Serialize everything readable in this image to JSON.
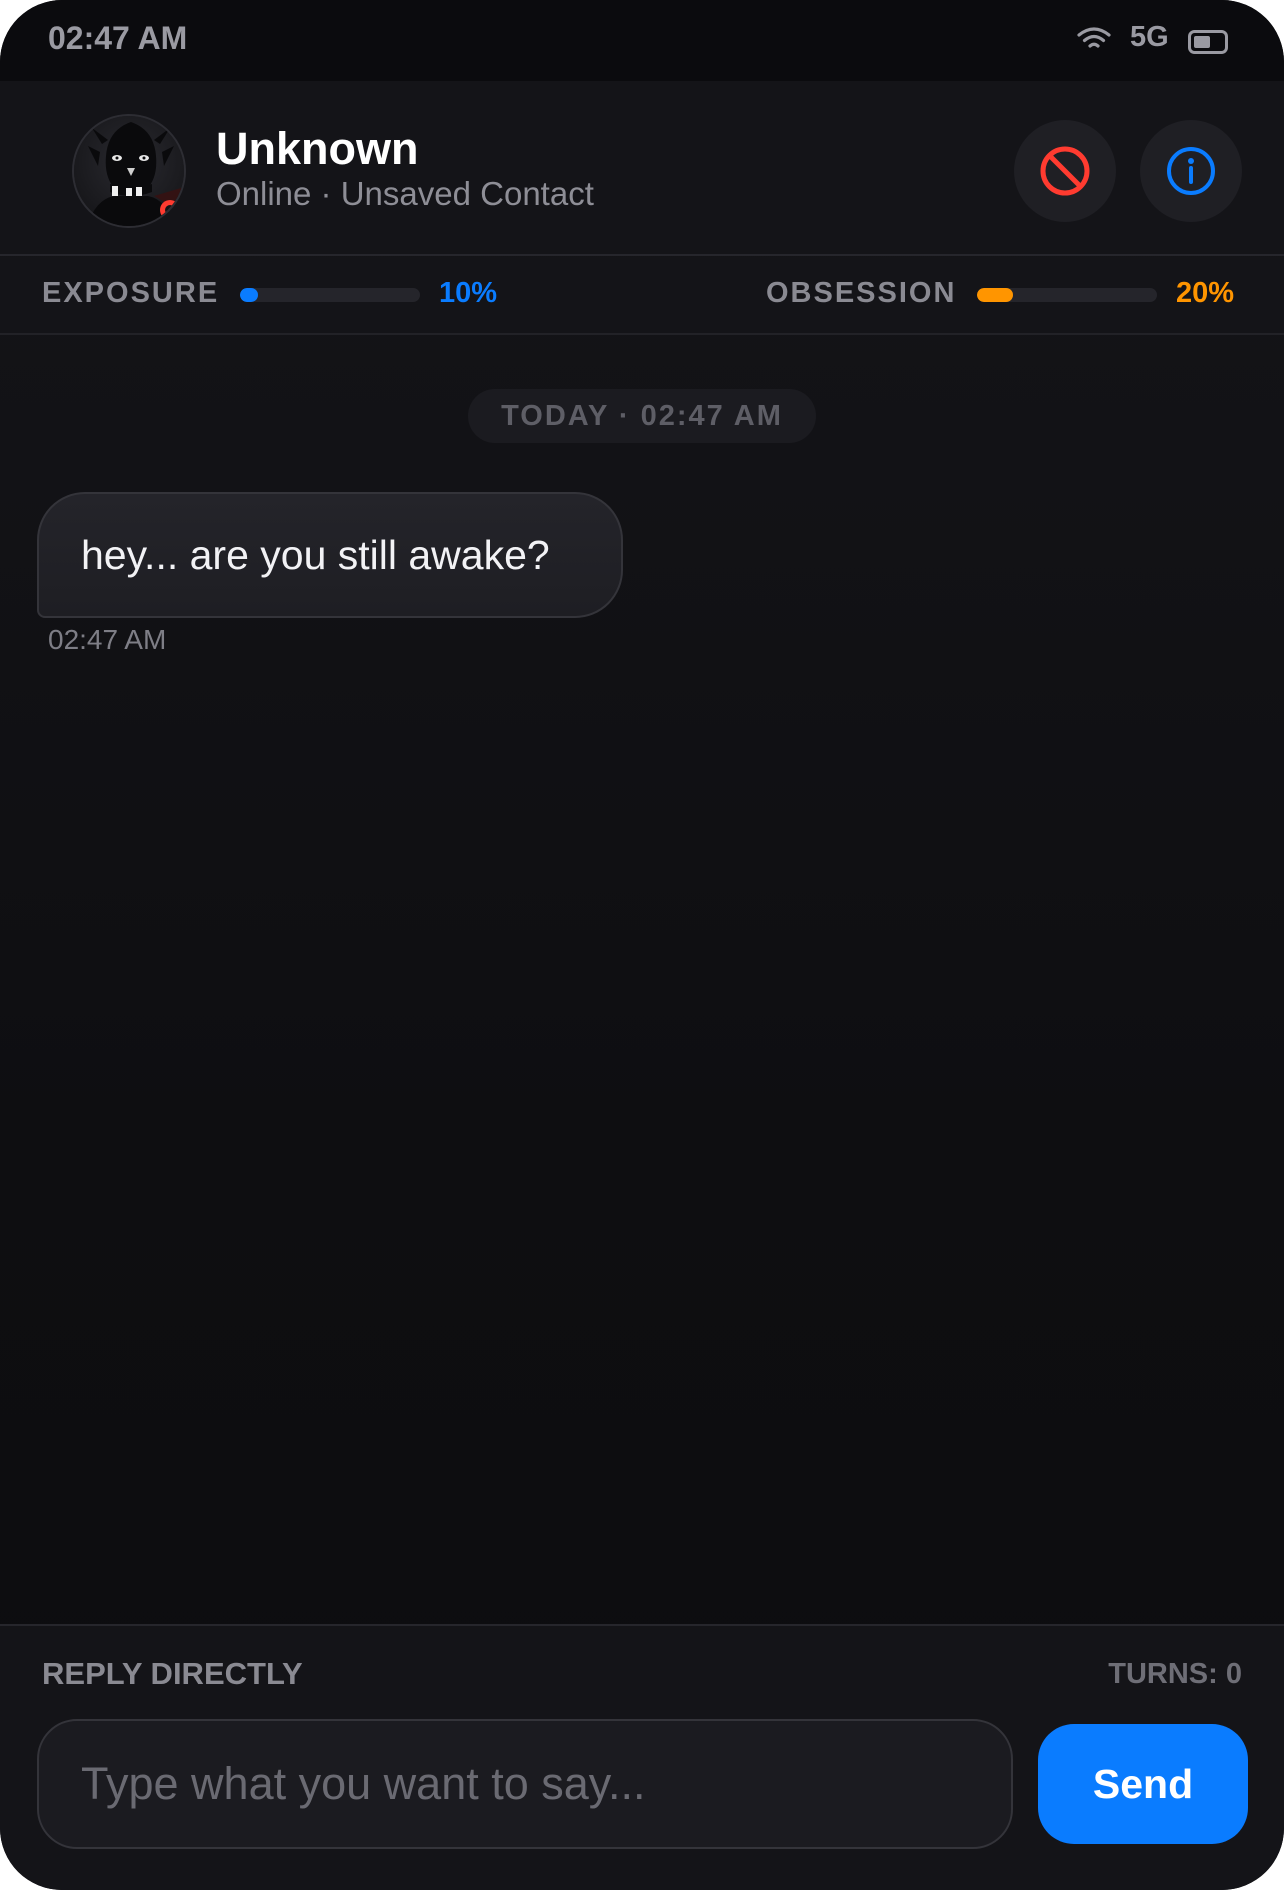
{
  "status_bar": {
    "time": "02:47 AM",
    "network": "5G",
    "wifi_icon": "wifi-icon",
    "battery_icon": "battery-icon"
  },
  "header": {
    "contact_name": "Unknown",
    "contact_status": "Online · Unsaved Contact",
    "avatar_icon": "demon-avatar",
    "block_icon": "block-icon",
    "info_icon": "info-icon"
  },
  "meters": {
    "exposure": {
      "label": "EXPOSURE",
      "value_text": "10%",
      "value": 0.1,
      "color": "#0a7cff"
    },
    "obsession": {
      "label": "OBSESSION",
      "value_text": "20%",
      "value": 0.2,
      "color": "#ff9500"
    }
  },
  "chat": {
    "date_divider": "TODAY · 02:47 AM",
    "messages": [
      {
        "sender": "Unknown",
        "text": "hey... are you still awake?",
        "time": "02:47 AM"
      }
    ]
  },
  "composer": {
    "label": "REPLY DIRECTLY",
    "turns": "TURNS: 0",
    "input_value": "",
    "input_placeholder": "Type what you want to say...",
    "send_label": "Send"
  },
  "colors": {
    "accent_blue": "#0a7cff",
    "accent_orange": "#ff9500",
    "danger_red": "#ff3b30",
    "background": "#0e0e11"
  }
}
